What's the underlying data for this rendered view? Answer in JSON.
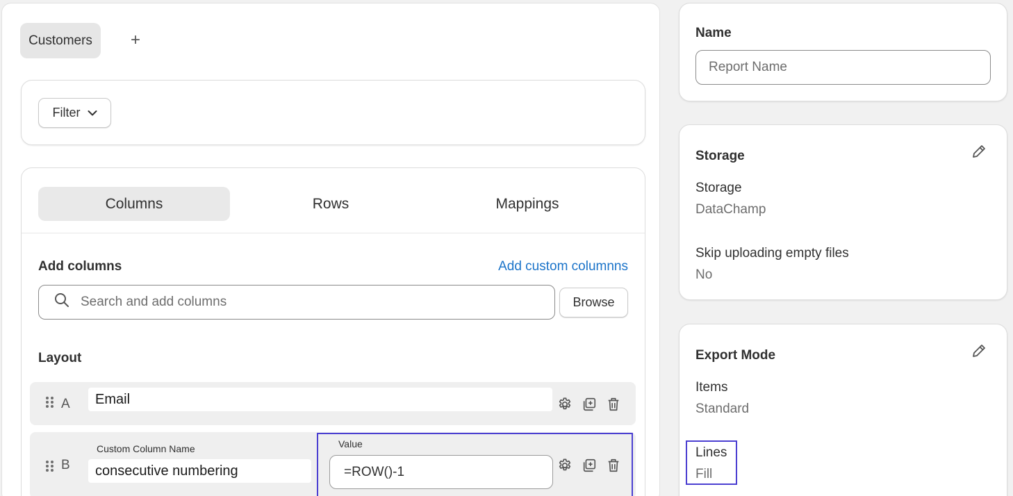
{
  "report_tabs": {
    "active": "Customers",
    "add_symbol": "+"
  },
  "filter": {
    "label": "Filter"
  },
  "tabs": [
    {
      "label": "Columns",
      "active": true
    },
    {
      "label": "Rows",
      "active": false
    },
    {
      "label": "Mappings",
      "active": false
    }
  ],
  "add_columns": {
    "title": "Add columns",
    "custom_link": "Add custom columnns",
    "search_placeholder": "Search and add columns",
    "browse_label": "Browse"
  },
  "layout": {
    "title": "Layout",
    "rows": [
      {
        "letter": "A",
        "name": "Email"
      },
      {
        "letter": "B",
        "name_label": "Custom Column Name",
        "name": "consecutive numbering",
        "value_label": "Value",
        "value": "=ROW()-1"
      }
    ]
  },
  "name_card": {
    "title": "Name",
    "placeholder": "Report Name"
  },
  "storage_card": {
    "title": "Storage",
    "fields": [
      {
        "label": "Storage",
        "value": "DataChamp"
      },
      {
        "label": "Skip uploading empty files",
        "value": "No"
      }
    ]
  },
  "export_card": {
    "title": "Export Mode",
    "fields": [
      {
        "label": "Items",
        "value": "Standard"
      },
      {
        "label": "Lines",
        "value": "Fill"
      }
    ]
  },
  "colors": {
    "accent_link": "#1a73c9",
    "highlight": "#4b3fd1"
  },
  "icons": [
    "plus-icon",
    "chevron-down-icon",
    "search-icon",
    "drag-handle-icon",
    "gear-icon",
    "duplicate-icon",
    "trash-icon",
    "pencil-icon"
  ]
}
